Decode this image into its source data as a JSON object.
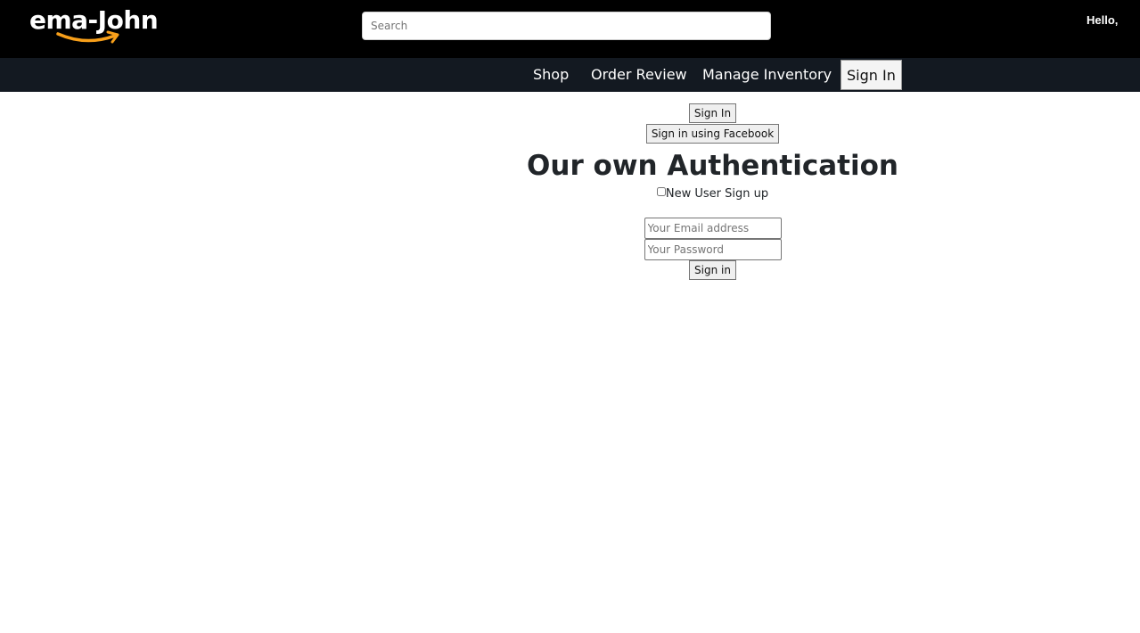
{
  "header": {
    "logo_text": "ema-John",
    "search_placeholder": "Search",
    "greeting": "Hello,"
  },
  "nav": {
    "items": [
      {
        "label": "Shop"
      },
      {
        "label": "Order Review"
      },
      {
        "label": "Manage Inventory"
      },
      {
        "label": "Sign In"
      }
    ]
  },
  "login": {
    "sign_in_button": "Sign In",
    "facebook_button": "Sign in using Facebook",
    "heading": "Our own Authentication",
    "new_user_label": "New User Sign up",
    "email_placeholder": "Your Email address",
    "password_placeholder": "Your Password",
    "submit_label": "Sign in"
  },
  "colors": {
    "topbar": "#000000",
    "navbar": "#131921",
    "logo_accent": "#f79f1a"
  }
}
